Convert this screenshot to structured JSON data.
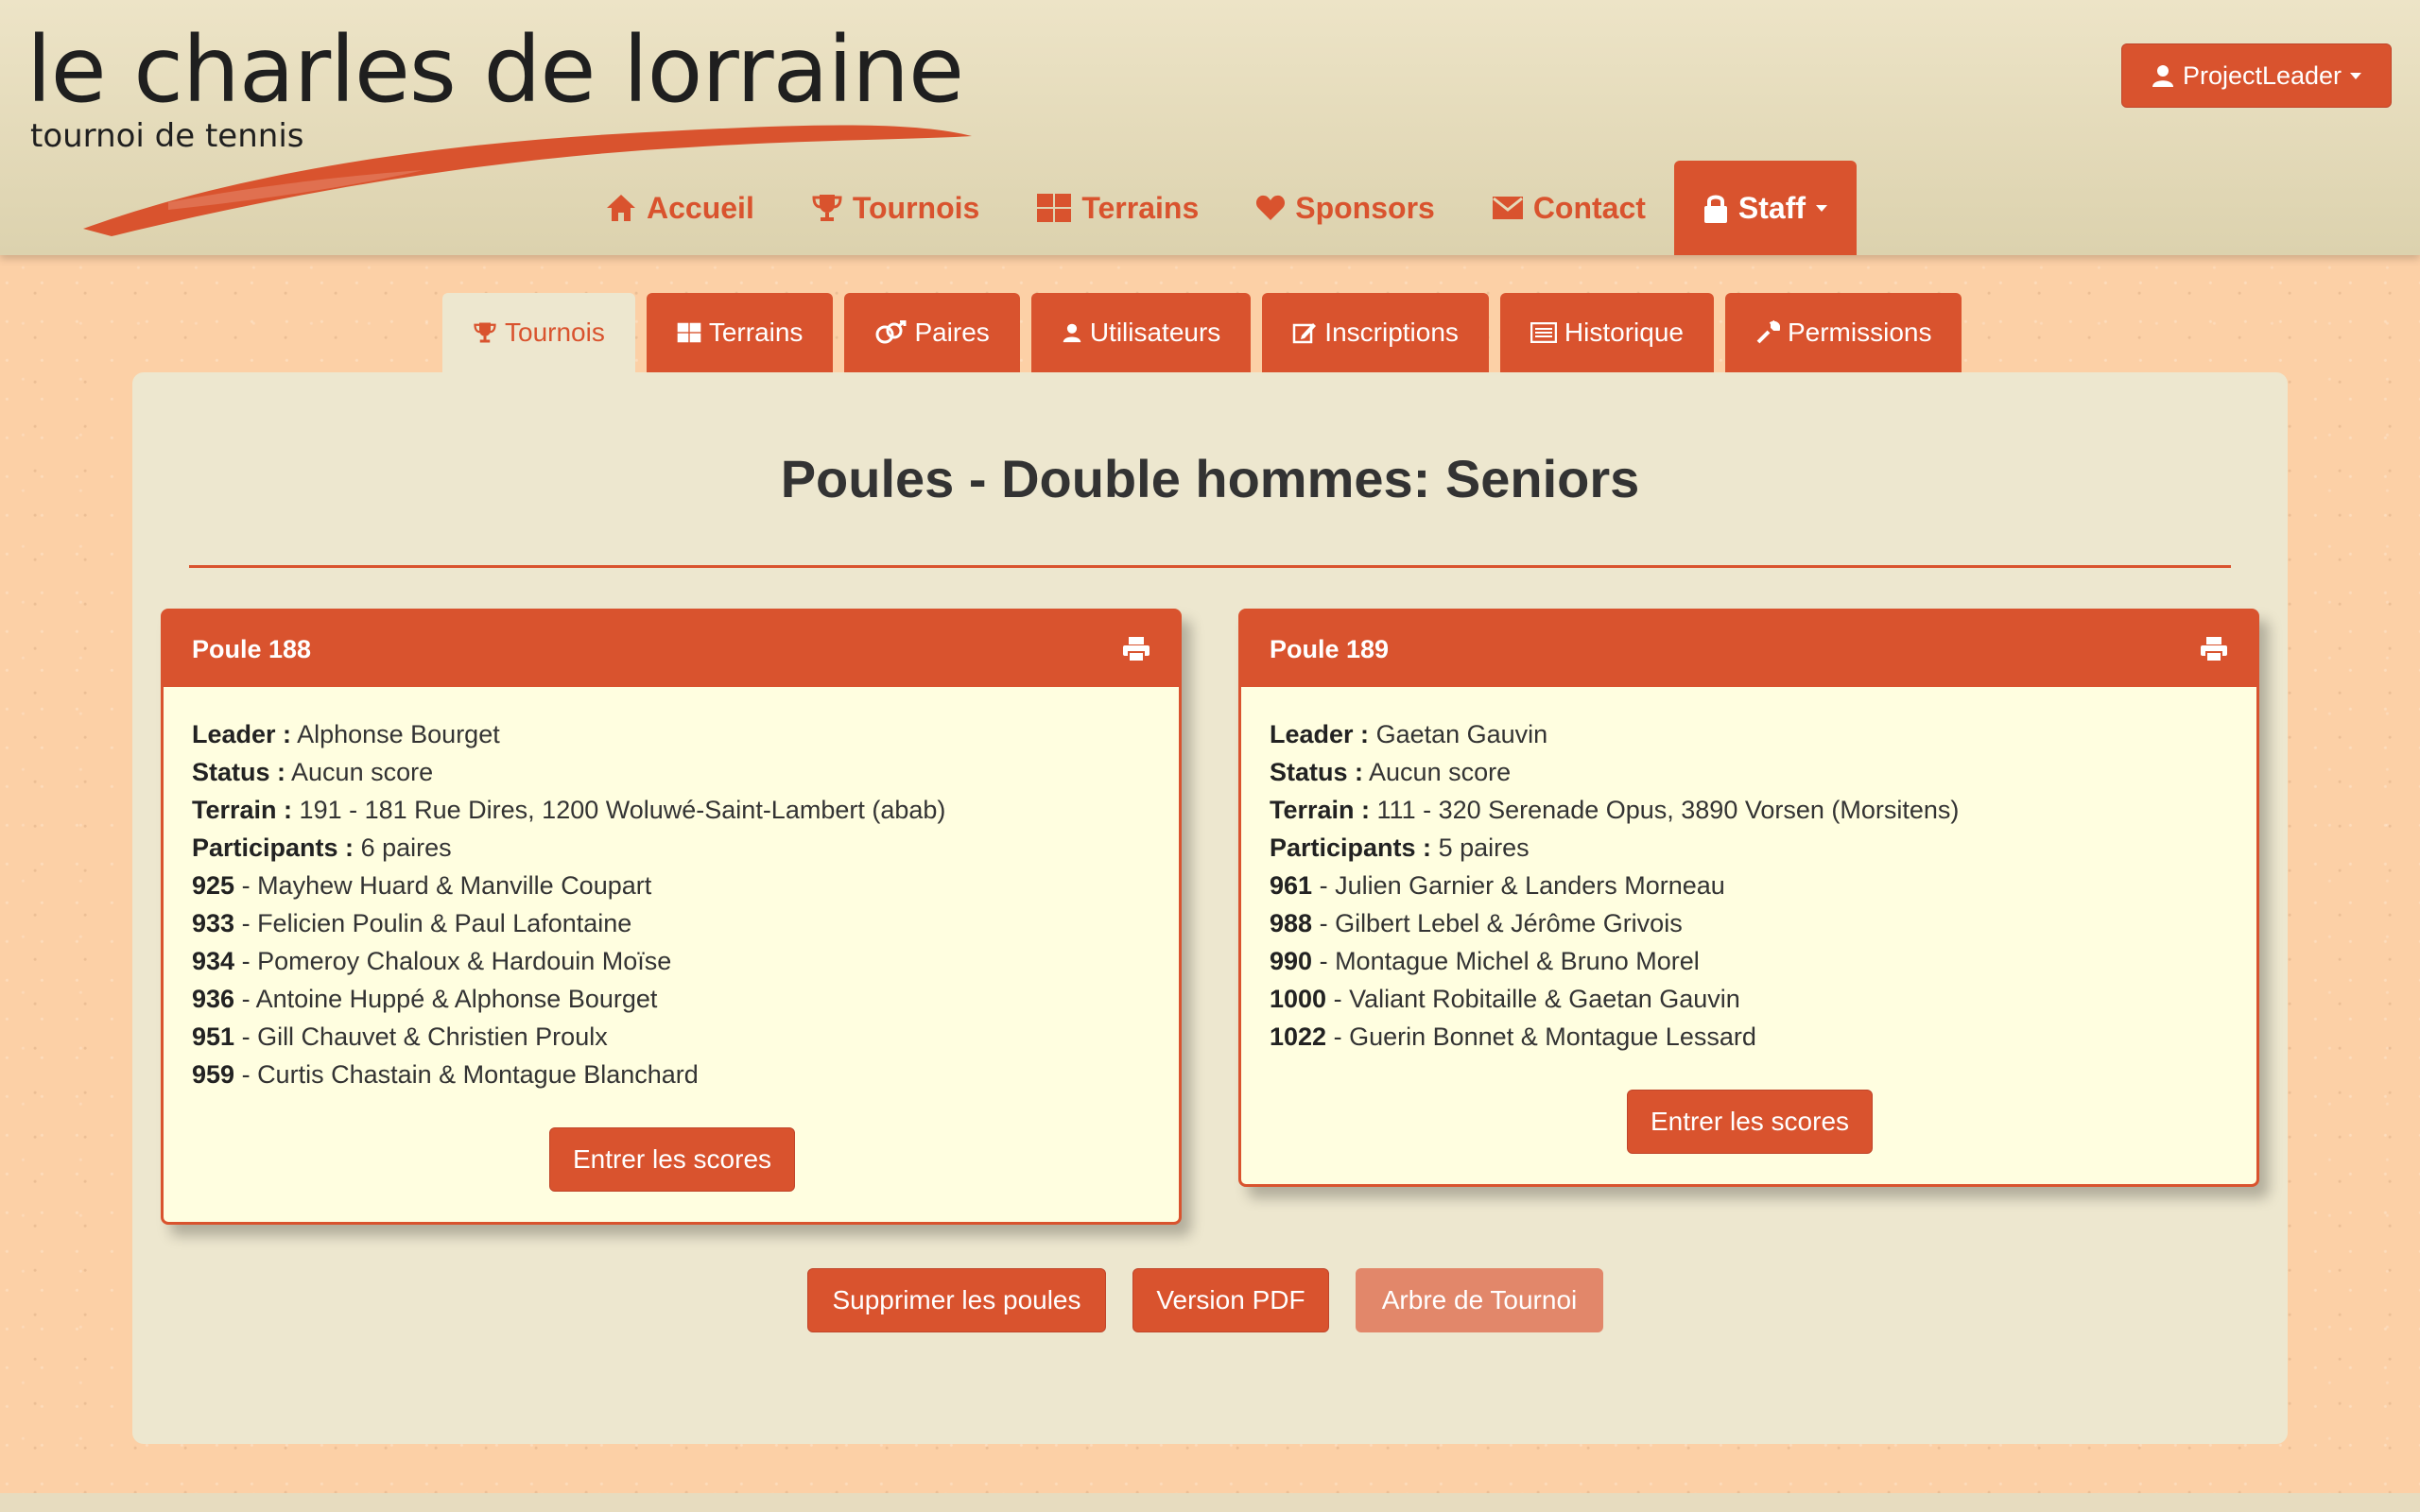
{
  "brand": {
    "title": "le charles de lorraine",
    "subtitle": "tournoi de tennis",
    "accent": "#d9532e"
  },
  "user_menu": {
    "label": "ProjectLeader"
  },
  "main_nav": [
    {
      "label": "Accueil",
      "icon": "home-icon"
    },
    {
      "label": "Tournois",
      "icon": "trophy-icon"
    },
    {
      "label": "Terrains",
      "icon": "grid-icon"
    },
    {
      "label": "Sponsors",
      "icon": "heart-icon"
    },
    {
      "label": "Contact",
      "icon": "envelope-icon"
    },
    {
      "label": "Staff",
      "icon": "lock-icon",
      "active": true
    }
  ],
  "staff_tabs": [
    {
      "label": "Tournois",
      "icon": "trophy-icon",
      "active": true
    },
    {
      "label": "Terrains",
      "icon": "grid-icon"
    },
    {
      "label": "Paires",
      "icon": "gender-icon"
    },
    {
      "label": "Utilisateurs",
      "icon": "user-icon"
    },
    {
      "label": "Inscriptions",
      "icon": "edit-icon"
    },
    {
      "label": "Historique",
      "icon": "list-icon"
    },
    {
      "label": "Permissions",
      "icon": "wrench-icon"
    }
  ],
  "page": {
    "title": "Poules - Double hommes: Seniors"
  },
  "labels": {
    "leader": "Leader :",
    "status": "Status :",
    "terrain": "Terrain :",
    "participants": "Participants :"
  },
  "poules": [
    {
      "title": "Poule 188",
      "leader": "Alphonse Bourget",
      "status": "Aucun score",
      "terrain": "191 - 181 Rue Dires, 1200 Woluwé-Saint-Lambert (abab)",
      "participants": "6 paires",
      "pairs": [
        {
          "id": "925",
          "names": "Mayhew Huard & Manville Coupart"
        },
        {
          "id": "933",
          "names": "Felicien Poulin & Paul Lafontaine"
        },
        {
          "id": "934",
          "names": "Pomeroy Chaloux & Hardouin Moïse"
        },
        {
          "id": "936",
          "names": "Antoine Huppé & Alphonse Bourget"
        },
        {
          "id": "951",
          "names": "Gill Chauvet & Christien Proulx"
        },
        {
          "id": "959",
          "names": "Curtis Chastain & Montague Blanchard"
        }
      ],
      "button": "Entrer les scores"
    },
    {
      "title": "Poule 189",
      "leader": "Gaetan Gauvin",
      "status": "Aucun score",
      "terrain": "111 - 320 Serenade Opus, 3890 Vorsen (Morsitens)",
      "participants": "5 paires",
      "pairs": [
        {
          "id": "961",
          "names": "Julien Garnier & Landers Morneau"
        },
        {
          "id": "988",
          "names": "Gilbert Lebel & Jérôme Grivois"
        },
        {
          "id": "990",
          "names": "Montague Michel & Bruno Morel"
        },
        {
          "id": "1000",
          "names": "Valiant Robitaille & Gaetan Gauvin"
        },
        {
          "id": "1022",
          "names": "Guerin Bonnet & Montague Lessard"
        }
      ],
      "button": "Entrer les scores"
    }
  ],
  "actions": {
    "delete": "Supprimer les poules",
    "pdf": "Version PDF",
    "tree": "Arbre de Tournoi"
  }
}
